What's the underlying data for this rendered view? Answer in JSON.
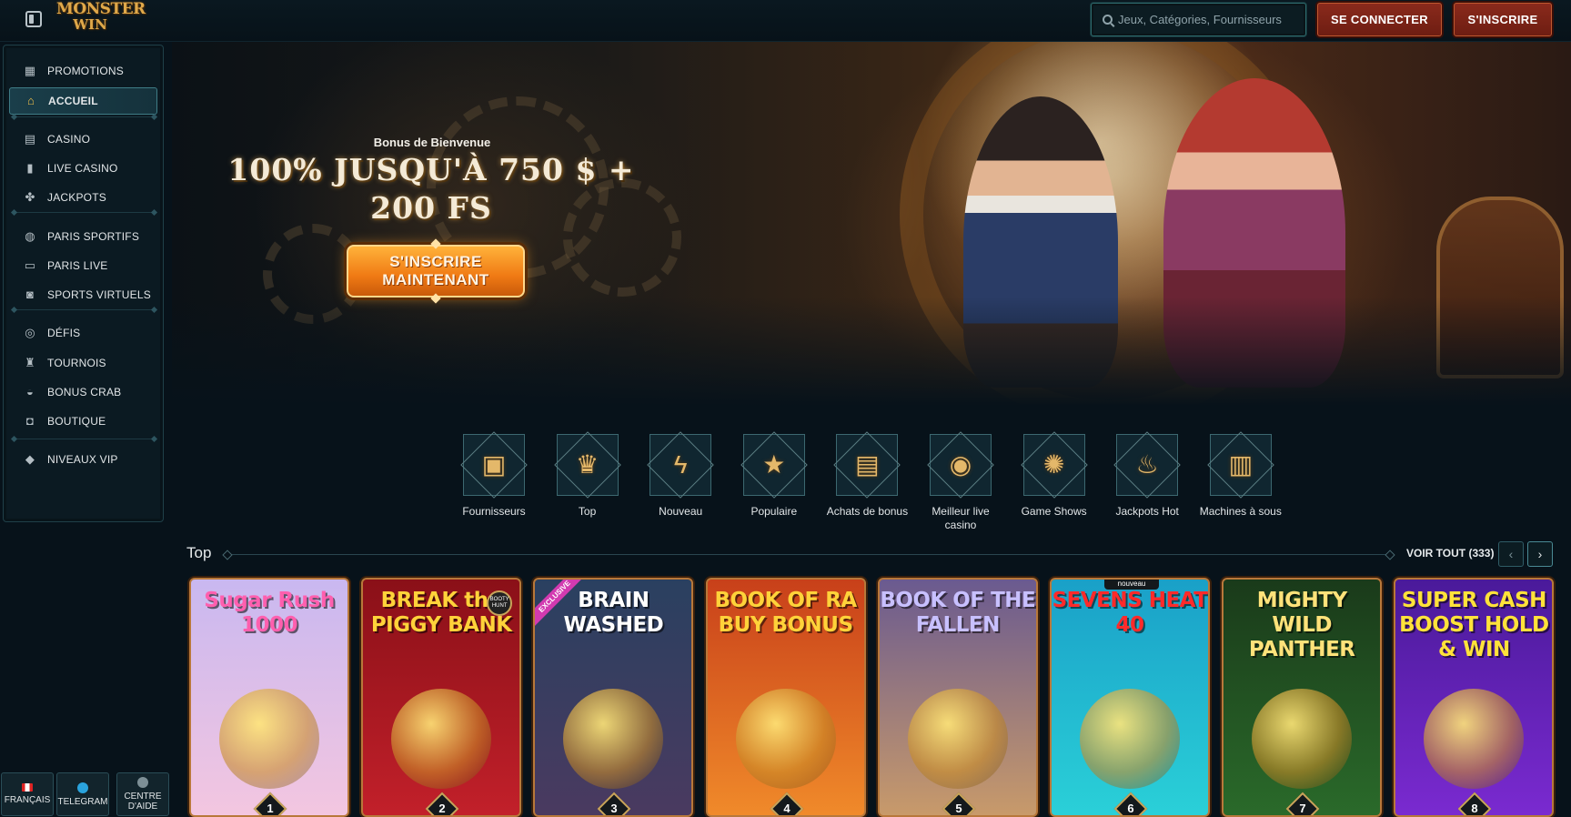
{
  "header": {
    "logo_line1": "MONSTER",
    "logo_line2": "WIN",
    "search_placeholder": "Jeux, Catégories, Fournisseurs",
    "login_label": "SE CONNECTER",
    "signup_label": "S'INSCRIRE"
  },
  "sidebar": {
    "items": [
      {
        "label": "PROMOTIONS",
        "icon": "gift-icon"
      },
      {
        "label": "ACCUEIL",
        "icon": "home-icon",
        "active": true
      },
      {
        "label": "CASINO",
        "icon": "slot-icon"
      },
      {
        "label": "LIVE CASINO",
        "icon": "phone-card-icon"
      },
      {
        "label": "JACKPOTS",
        "icon": "clover-icon"
      },
      {
        "label": "PARIS SPORTIFS",
        "icon": "ball-icon"
      },
      {
        "label": "PARIS LIVE",
        "icon": "live-icon"
      },
      {
        "label": "SPORTS VIRTUELS",
        "icon": "virtual-icon"
      },
      {
        "label": "DÉFIS",
        "icon": "target-icon"
      },
      {
        "label": "TOURNOIS",
        "icon": "trophy-icon"
      },
      {
        "label": "BONUS CRAB",
        "icon": "crab-icon"
      },
      {
        "label": "BOUTIQUE",
        "icon": "bag-icon"
      },
      {
        "label": "NIVEAUX VIP",
        "icon": "diamond-icon"
      }
    ],
    "bottom": [
      {
        "label": "FRANÇAIS",
        "icon": "flag-icon"
      },
      {
        "label": "TELEGRAM",
        "icon": "telegram-icon"
      },
      {
        "label": "CENTRE D'AIDE",
        "icon": "help-icon"
      }
    ]
  },
  "hero": {
    "subtitle": "Bonus de Bienvenue",
    "title": "100% JUSQU'À 750 $ + 200 FS",
    "cta": "S'INSCRIRE MAINTENANT"
  },
  "categories": [
    {
      "label": "Fournisseurs",
      "icon": "book-icon",
      "glyph": "▣"
    },
    {
      "label": "Top",
      "icon": "crown-icon",
      "glyph": "♛"
    },
    {
      "label": "Nouveau",
      "icon": "lightning-icon",
      "glyph": "ϟ"
    },
    {
      "label": "Populaire",
      "icon": "star-icon",
      "glyph": "★"
    },
    {
      "label": "Achats de bonus",
      "icon": "chest-icon",
      "glyph": "▤"
    },
    {
      "label": "Meilleur live casino",
      "icon": "chip-icon",
      "glyph": "◉"
    },
    {
      "label": "Game Shows",
      "icon": "wheel-icon",
      "glyph": "✺"
    },
    {
      "label": "Jackpots Hot",
      "icon": "flame-icon",
      "glyph": "♨"
    },
    {
      "label": "Machines à sous",
      "icon": "slot-machine-icon",
      "glyph": "▥"
    }
  ],
  "top_section": {
    "title": "Top",
    "see_all": "VOIR TOUT (333)"
  },
  "games": [
    {
      "title": "Sugar Rush 1000",
      "rank": "1",
      "colors": [
        "#c9b8f0",
        "#f3c6e0"
      ],
      "text_color": "#ff5fae"
    },
    {
      "title": "BREAK the PIGGY BANK",
      "rank": "2",
      "colors": [
        "#8a1018",
        "#c2202a"
      ],
      "text_color": "#ffd23a",
      "tag": "BOOTY HUNT"
    },
    {
      "title": "BRAIN WASHED",
      "rank": "3",
      "colors": [
        "#2a4060",
        "#4a3a60"
      ],
      "text_color": "#ffffff",
      "badge": "EXCLUSIVE"
    },
    {
      "title": "BOOK OF RA BUY BONUS",
      "rank": "4",
      "colors": [
        "#c8401a",
        "#f08a2a"
      ],
      "text_color": "#ffd23a"
    },
    {
      "title": "BOOK OF THE FALLEN",
      "rank": "5",
      "colors": [
        "#6a5a90",
        "#c89a6a"
      ],
      "text_color": "#c8c0ff"
    },
    {
      "title": "SEVENS HEAT 40",
      "rank": "6",
      "colors": [
        "#1aa0c8",
        "#2ad0d8"
      ],
      "text_color": "#ff2a2a",
      "badge_new": "nouveau"
    },
    {
      "title": "MIGHTY WILD PANTHER",
      "rank": "7",
      "colors": [
        "#1a3a1a",
        "#2a6a2a"
      ],
      "text_color": "#ffe27a"
    },
    {
      "title": "SUPER CASH BOOST HOLD & WIN",
      "rank": "8",
      "colors": [
        "#4a1a9a",
        "#7a2ad0"
      ],
      "text_color": "#ffe23a"
    }
  ]
}
